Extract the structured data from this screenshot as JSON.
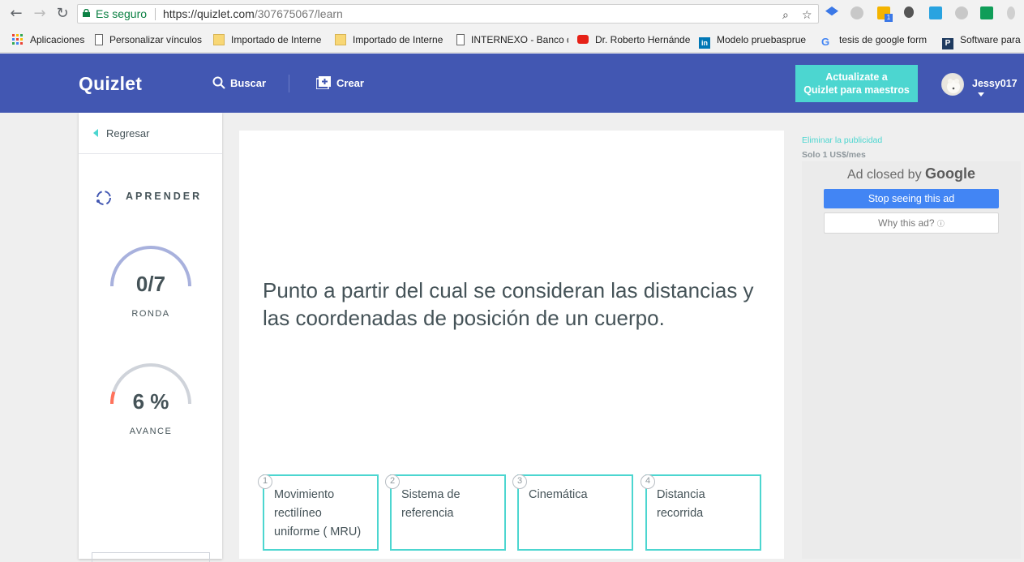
{
  "browser": {
    "secure_label": "Es seguro",
    "url_host": "https://quizlet.com",
    "url_path": "/307675067/learn",
    "bookmarks": [
      {
        "label": "Aplicaciones",
        "icon": "apps-grid-icon"
      },
      {
        "label": "Personalizar vínculos",
        "icon": "page-icon"
      },
      {
        "label": "Importado de Interne",
        "icon": "folder-icon"
      },
      {
        "label": "Importado de Interne",
        "icon": "folder-icon"
      },
      {
        "label": "INTERNEXO - Banco d",
        "icon": "page-icon"
      },
      {
        "label": "Dr. Roberto Hernánde",
        "icon": "youtube-icon"
      },
      {
        "label": "Modelo pruebasprue",
        "icon": "linkedin-icon"
      },
      {
        "label": "tesis de google form",
        "icon": "google-icon"
      },
      {
        "label": "Software para",
        "icon": "p-app-icon"
      }
    ],
    "extension_badge": "1"
  },
  "header": {
    "logo": "Quizlet",
    "search_label": "Buscar",
    "create_label": "Crear",
    "upgrade_line1": "Actualizate a",
    "upgrade_line2": "Quizlet para maestros",
    "username": "Jessy017"
  },
  "sidebar": {
    "back_label": "Regresar",
    "mode_label": "APRENDER",
    "round": {
      "value": "0/7",
      "label": "RONDA",
      "fraction": 0.0
    },
    "progress": {
      "value": "6 %",
      "label": "AVANCE",
      "fraction": 0.06
    }
  },
  "question": {
    "text": "Punto a partir del cual se consideran las distancias y las coordenadas de posición de un cuerpo.",
    "options": [
      {
        "number": "1",
        "text": "Movimiento rectilíneo uniforme ( MRU)"
      },
      {
        "number": "2",
        "text": "Sistema de referencia"
      },
      {
        "number": "3",
        "text": "Cinemática"
      },
      {
        "number": "4",
        "text": "Distancia recorrida"
      }
    ]
  },
  "ads": {
    "remove_label": "Eliminar la publicidad",
    "price_label": "Solo 1 US$/mes",
    "closed_by": "Ad closed by",
    "google_word": "Google",
    "stop_label": "Stop seeing this ad",
    "why_label": "Why this ad?",
    "info_glyph": "ⓘ"
  },
  "colors": {
    "header_bg": "#4257b2",
    "accent": "#4cd6d0",
    "round_arc": "#a8b1dd",
    "progress_arc": "#cfd3da",
    "progress_fill": "#ff725b",
    "ad_button": "#4285f4"
  }
}
